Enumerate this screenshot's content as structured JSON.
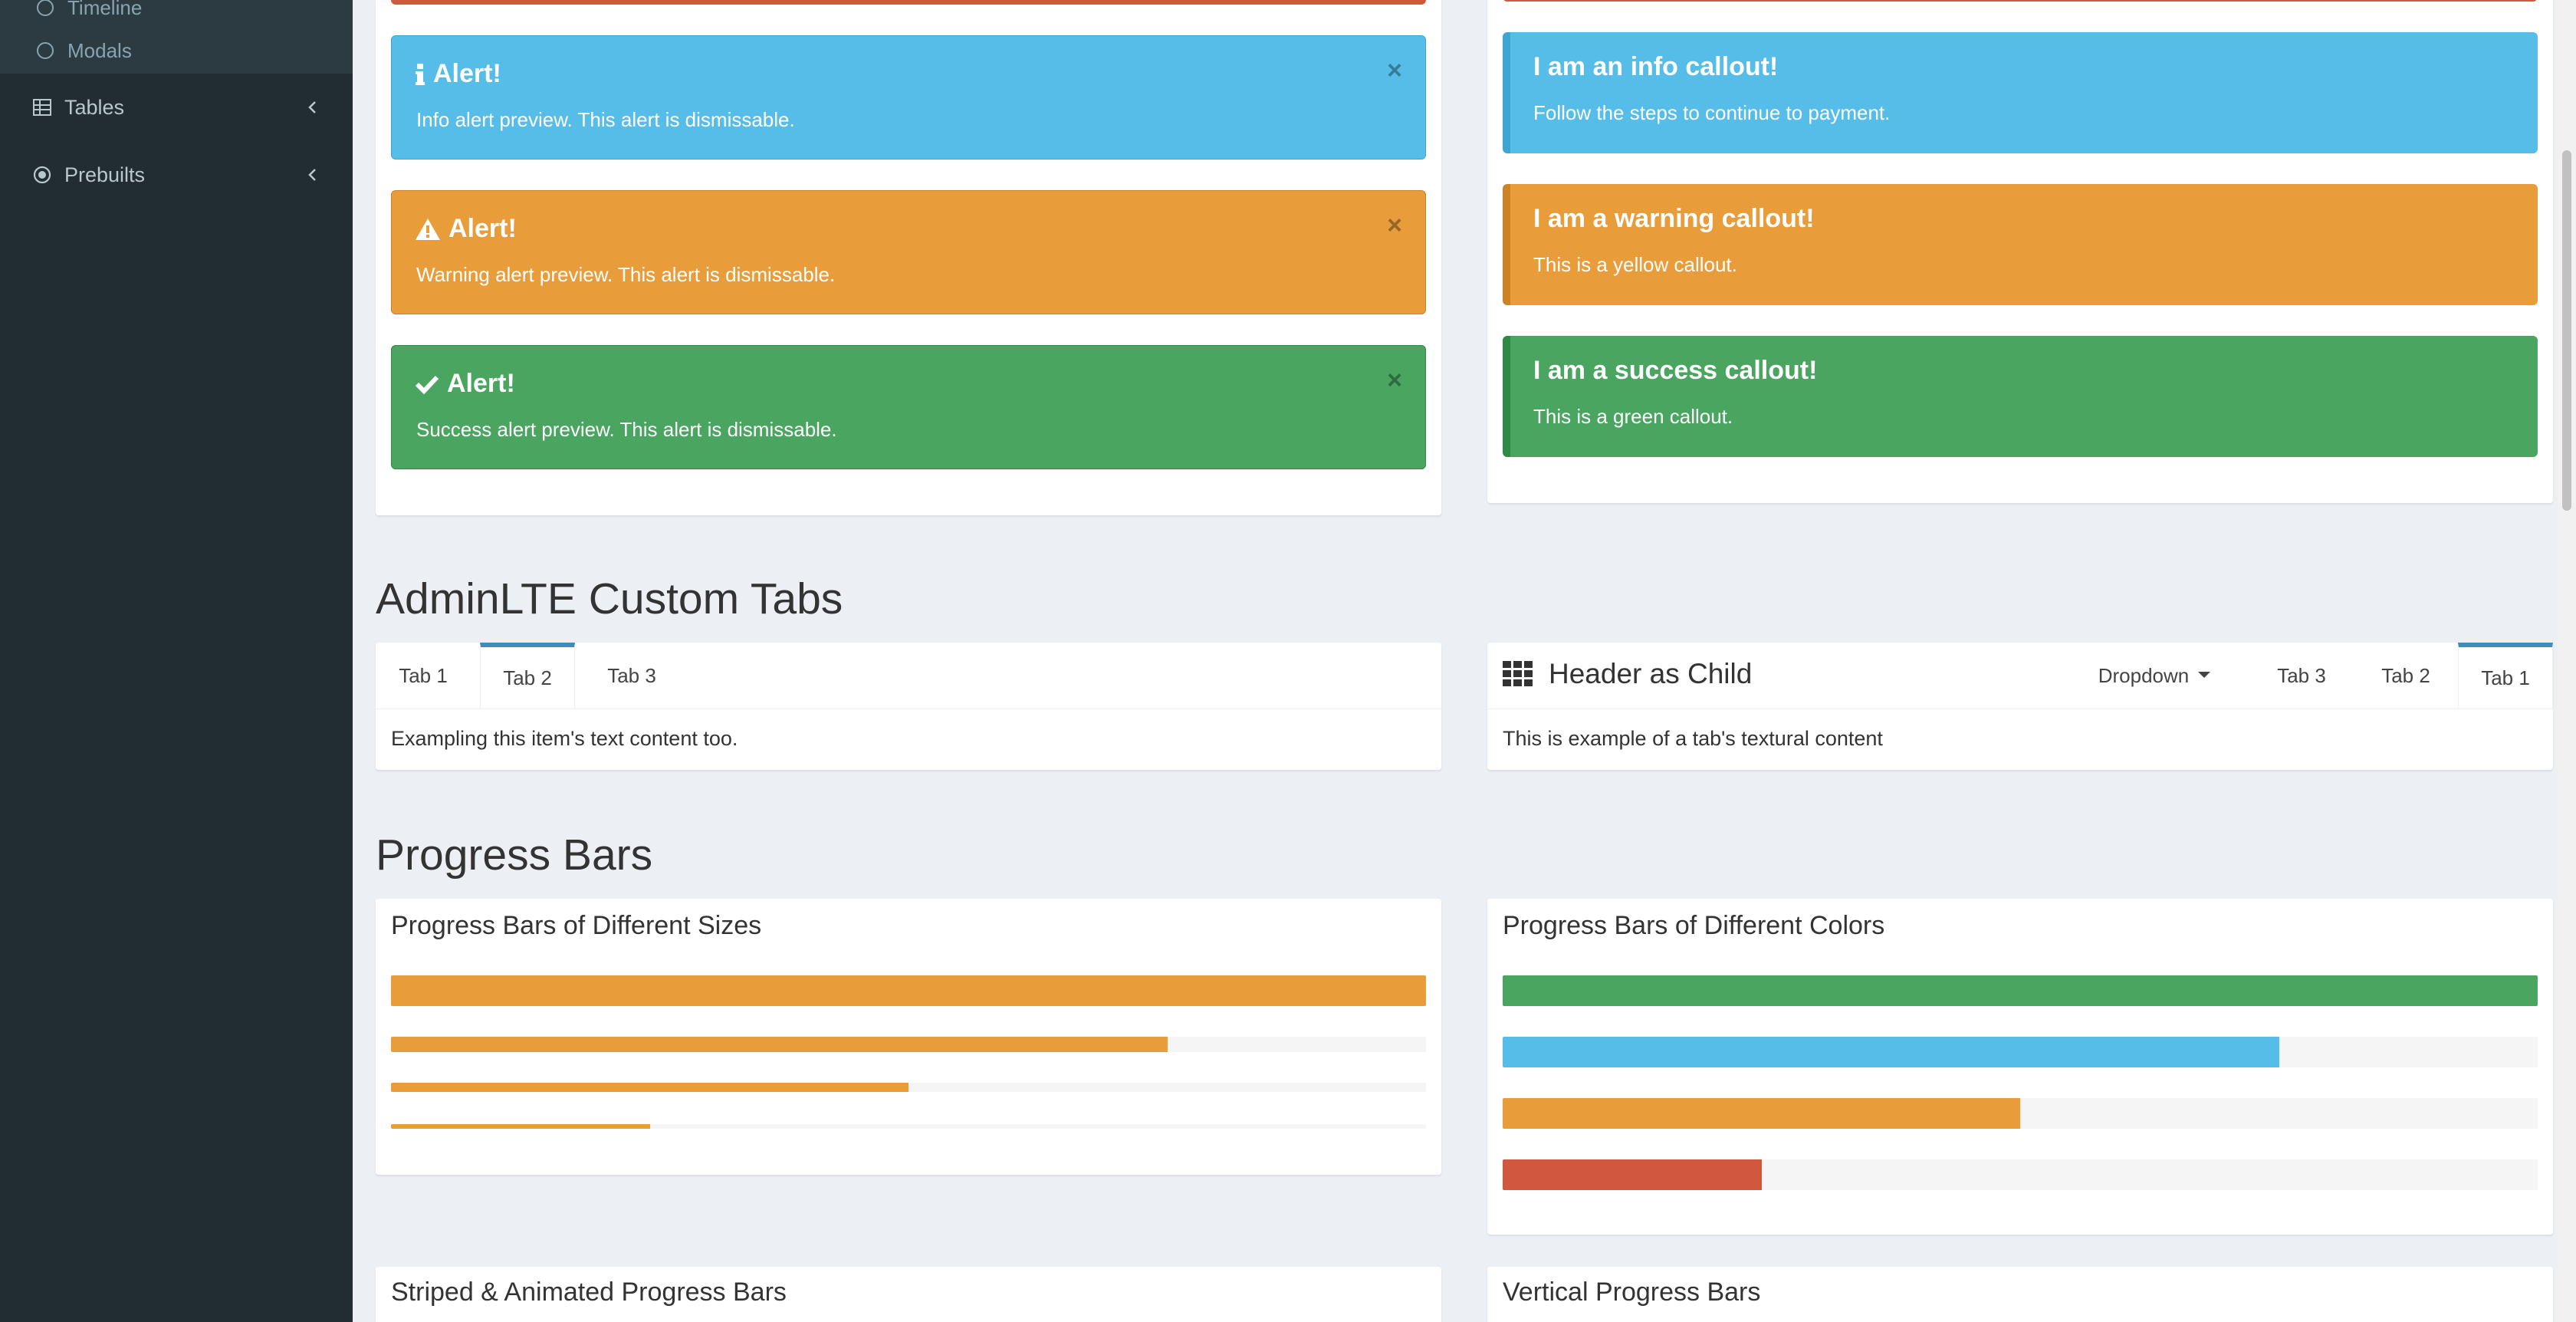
{
  "sidebar": {
    "sub_items": [
      {
        "label": "Timeline"
      },
      {
        "label": "Modals"
      }
    ],
    "items": [
      {
        "label": "Tables",
        "icon": "table-icon"
      },
      {
        "label": "Prebuilts",
        "icon": "circle-dot-icon"
      }
    ]
  },
  "alerts": [
    {
      "title": "Alert!",
      "message": "Info alert preview. This alert is dismissable.",
      "icon": "info-icon",
      "color": "#56bde9",
      "close": "×"
    },
    {
      "title": "Alert!",
      "message": "Warning alert preview. This alert is dismissable.",
      "icon": "warning-icon",
      "color": "#e99c3a",
      "close": "×"
    },
    {
      "title": "Alert!",
      "message": "Success alert preview. This alert is dismissable.",
      "icon": "check-icon",
      "color": "#49a55f",
      "close": "×"
    }
  ],
  "callouts": [
    {
      "title": "I am an info callout!",
      "message": "Follow the steps to continue to payment.",
      "color": "#56bde9",
      "border": "#3fa6d3"
    },
    {
      "title": "I am a warning callout!",
      "message": "This is a yellow callout.",
      "color": "#e99c3a",
      "border": "#cc8326"
    },
    {
      "title": "I am a success callout!",
      "message": "This is a green callout.",
      "color": "#49a55f",
      "border": "#2f8a45"
    }
  ],
  "custom_tabs": {
    "section_title": "AdminLTE Custom Tabs",
    "left": {
      "tabs": [
        "Tab 1",
        "Tab 2",
        "Tab 3"
      ],
      "active_tab": "Tab 2",
      "content": "Exampling this item's text content too."
    },
    "right": {
      "header": "Header as Child",
      "header_icon": "grid-icon",
      "dropdown": "Dropdown",
      "tabs": [
        "Tab 3",
        "Tab 2",
        "Tab 1"
      ],
      "active_tab": "Tab 1",
      "content": "This is example of a tab's textural content"
    }
  },
  "progress": {
    "section_title": "Progress Bars",
    "sizes_box": {
      "title": "Progress Bars of Different Sizes",
      "values": [
        100,
        75,
        50,
        25
      ],
      "color": "#e99c3a"
    },
    "colors_box": {
      "title": "Progress Bars of Different Colors",
      "bars": [
        {
          "value": 100,
          "color": "#49a55f"
        },
        {
          "value": 75,
          "color": "#56bde9"
        },
        {
          "value": 50,
          "color": "#e99c3a"
        },
        {
          "value": 25,
          "color": "#d2573f"
        }
      ]
    },
    "striped_box": {
      "title": "Striped & Animated Progress Bars"
    },
    "vertical_box": {
      "title": "Vertical Progress Bars"
    }
  }
}
